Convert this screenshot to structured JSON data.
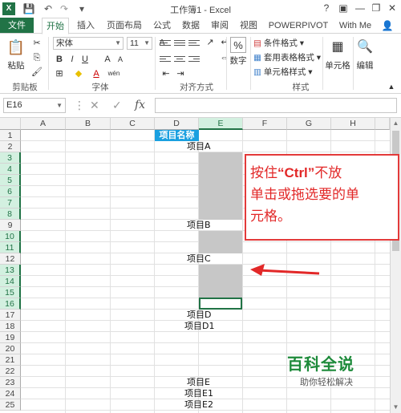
{
  "window": {
    "title": "工作簿1 - Excel",
    "help": "?",
    "minimize": "—",
    "restore": "❐",
    "close": "✕"
  },
  "quick_access": {
    "save": "💾",
    "undo": "↶",
    "redo": "↷",
    "more": "▾"
  },
  "tabs": [
    {
      "label": "文件",
      "type": "file"
    },
    {
      "label": "开始",
      "type": "active"
    },
    {
      "label": "插入",
      "type": "normal"
    },
    {
      "label": "页面布局",
      "type": "normal"
    },
    {
      "label": "公式",
      "type": "normal"
    },
    {
      "label": "数据",
      "type": "normal"
    },
    {
      "label": "审阅",
      "type": "normal"
    },
    {
      "label": "视图",
      "type": "normal"
    },
    {
      "label": "POWERPIVOT",
      "type": "normal"
    },
    {
      "label": "With Me",
      "type": "normal"
    }
  ],
  "ribbon": {
    "clipboard": {
      "paste_label": "粘贴",
      "group_label": "剪贴板"
    },
    "font": {
      "font_name": "宋体",
      "font_size": "11",
      "bold": "B",
      "italic": "I",
      "underline": "U",
      "grow": "A",
      "shrink": "A",
      "color_a": "A",
      "wen": "wén",
      "group_label": "字体"
    },
    "alignment": {
      "group_label": "对齐方式"
    },
    "number": {
      "label": "数字",
      "symbol": "%"
    },
    "styles": {
      "conditional": "条件格式 ▾",
      "table": "套用表格格式 ▾",
      "cell": "单元格样式 ▾",
      "group_label": "样式"
    },
    "cells": {
      "label": "单元格"
    },
    "editing": {
      "label": "编辑"
    }
  },
  "formula_bar": {
    "name_box": "E16",
    "fx": "fx",
    "cancel": "✕",
    "enter": "✓",
    "value": ""
  },
  "columns": [
    "A",
    "B",
    "C",
    "D",
    "E",
    "F",
    "G",
    "H"
  ],
  "rows": [
    "1",
    "2",
    "3",
    "4",
    "5",
    "6",
    "7",
    "8",
    "9",
    "10",
    "11",
    "12",
    "13",
    "14",
    "15",
    "16",
    "17",
    "18",
    "19",
    "20",
    "21",
    "22",
    "23",
    "24",
    "25"
  ],
  "cells": {
    "d1": "项目名称",
    "e2": "项目A",
    "e9": "项目B",
    "e12": "项目C",
    "e17": "项目D",
    "e18": "项目D1",
    "e23": "项目E",
    "e24": "项目E1",
    "e25": "项目E2"
  },
  "annotation": {
    "line1_pre": "按住",
    "line1_key": "“Ctrl”",
    "line1_post": "不放",
    "line2": "单击或拖选要的单",
    "line3": "元格。"
  },
  "watermark": {
    "title": "百科全说",
    "subtitle": "助你轻松解决"
  },
  "colors": {
    "excel_green": "#217346",
    "selection_gray": "#c7c7c7",
    "header_cyan": "#1aa0e0",
    "annotation_red": "#e22828"
  }
}
